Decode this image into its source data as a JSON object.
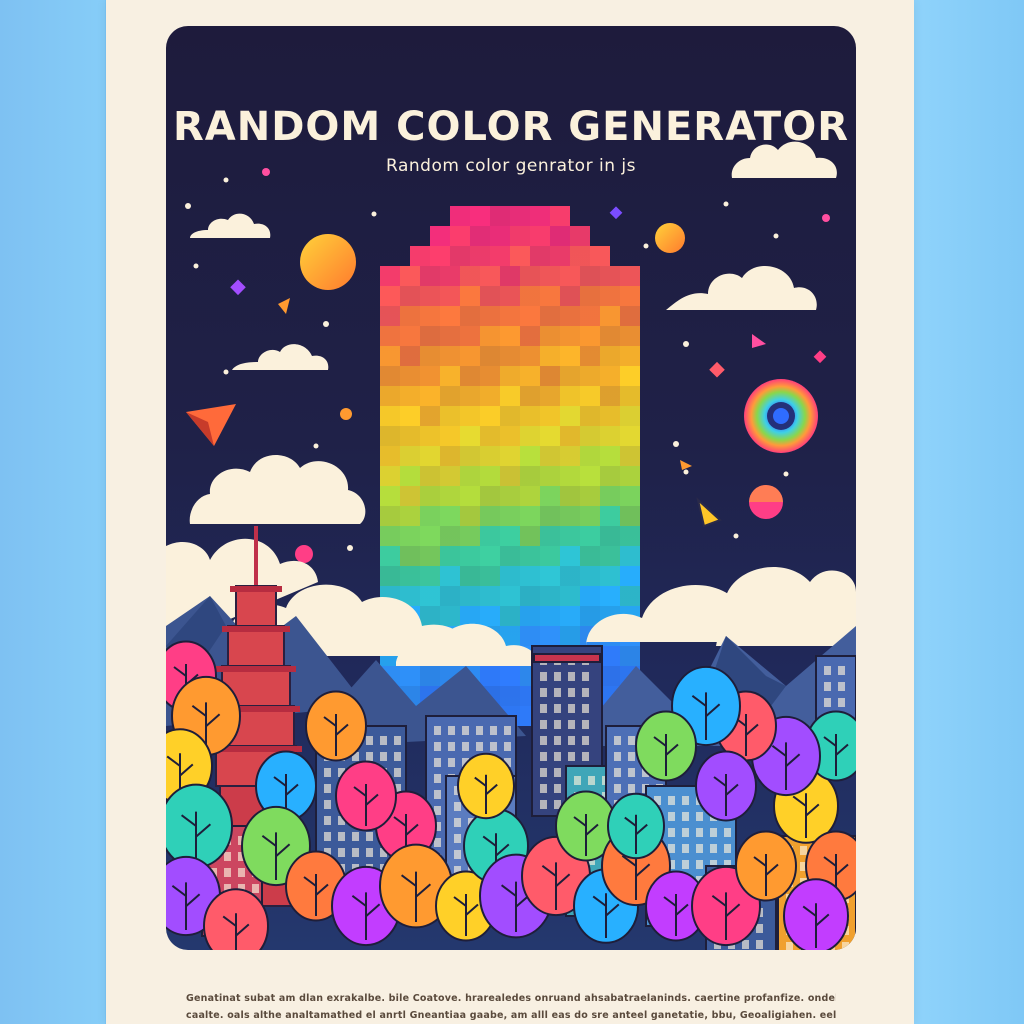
{
  "poster": {
    "title": "RANDOM COLOR GENERATOR",
    "subtitle": "Random color genrator in js"
  },
  "footer": {
    "line1": "Genatinat subat am dlan exrakalbe.   bile Coatove.   hrarealedes onruand ahsabatraelaninds.   caertine profanfize.   ondelenotdie.",
    "line2": "caalte.  oals  althe  analtamathed  el  anrtl  Gneantiaa  gaabe,   am  alll  eas  do  sre  anteel  ganetatie,  bbu,  Geoaligiahen.  eelle."
  },
  "colors": {
    "sky_top": "#1e1b3c",
    "cloud": "#fbf1dc",
    "paper": "#f8f0e2",
    "page_bg": "#7cc6f6"
  },
  "icons": [
    "paper-plane-icon",
    "cursor-icon",
    "color-wheel-icon",
    "sun-icon",
    "star-icon"
  ]
}
